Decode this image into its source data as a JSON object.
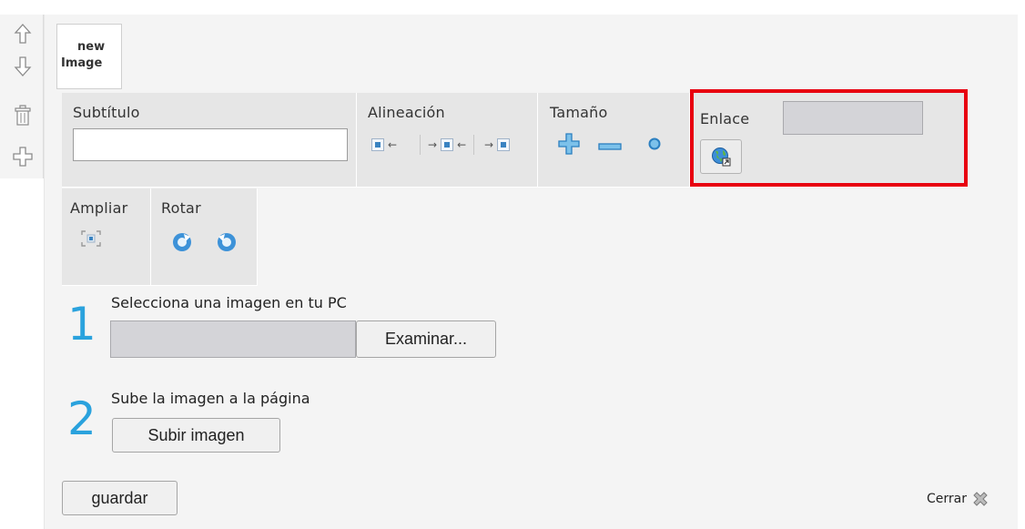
{
  "tab": {
    "line1": "new",
    "line2": "Image"
  },
  "toolbar": {
    "subtitle_label": "Subtítulo",
    "subtitle_value": "",
    "alignment_label": "Alineación",
    "size_label": "Tamaño",
    "link_label": "Enlace",
    "link_value": "",
    "zoom_label": "Ampliar",
    "rotate_label": "Rotar"
  },
  "steps": [
    {
      "number": "1",
      "text": "Selecciona una imagen en tu PC",
      "button": "Examinar...",
      "file_value": ""
    },
    {
      "number": "2",
      "text": "Sube la imagen a la página",
      "button": "Subir imagen"
    }
  ],
  "footer": {
    "save_label": "guardar",
    "close_label": "Cerrar"
  },
  "colors": {
    "accent_blue": "#2aa2dd",
    "highlight_red": "#e8000f",
    "icon_blue": "#3a83c1"
  }
}
